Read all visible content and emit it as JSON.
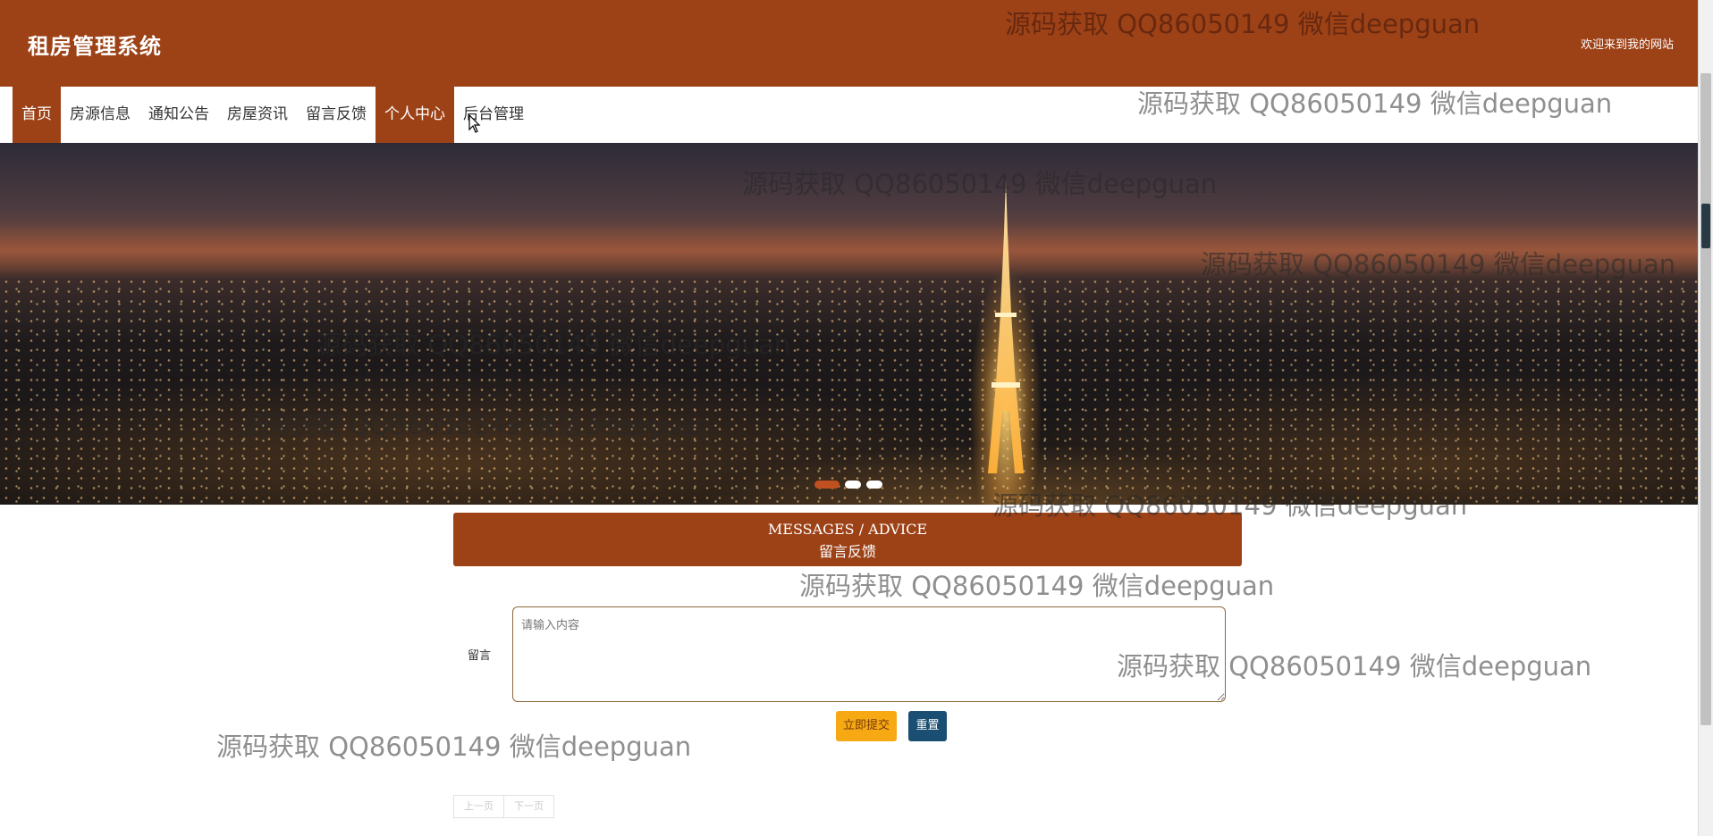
{
  "header": {
    "site_title": "租房管理系统",
    "welcome_text": "欢迎来到我的网站",
    "background_color": "#9d4217"
  },
  "nav": {
    "items": [
      {
        "label": "首页",
        "active": true
      },
      {
        "label": "房源信息",
        "active": false
      },
      {
        "label": "通知公告",
        "active": false
      },
      {
        "label": "房屋资讯",
        "active": false
      },
      {
        "label": "留言反馈",
        "active": false
      },
      {
        "label": "个人中心",
        "active": true
      },
      {
        "label": "后台管理",
        "active": false
      }
    ]
  },
  "carousel": {
    "slide_count": 3,
    "active_index": 0
  },
  "section": {
    "title_en": "MESSAGES / ADVICE",
    "title_cn": "留言反馈"
  },
  "form": {
    "label": "留言",
    "textarea_value": "",
    "textarea_placeholder": "请输入内容",
    "submit_label": "立即提交",
    "reset_label": "重置",
    "submit_color": "#f6a913",
    "reset_color": "#1a4f73"
  },
  "pager": {
    "prev_label": "上一页",
    "next_label": "下一页"
  },
  "watermark": {
    "text": "源码获取 QQ86050149 微信deepguan"
  }
}
